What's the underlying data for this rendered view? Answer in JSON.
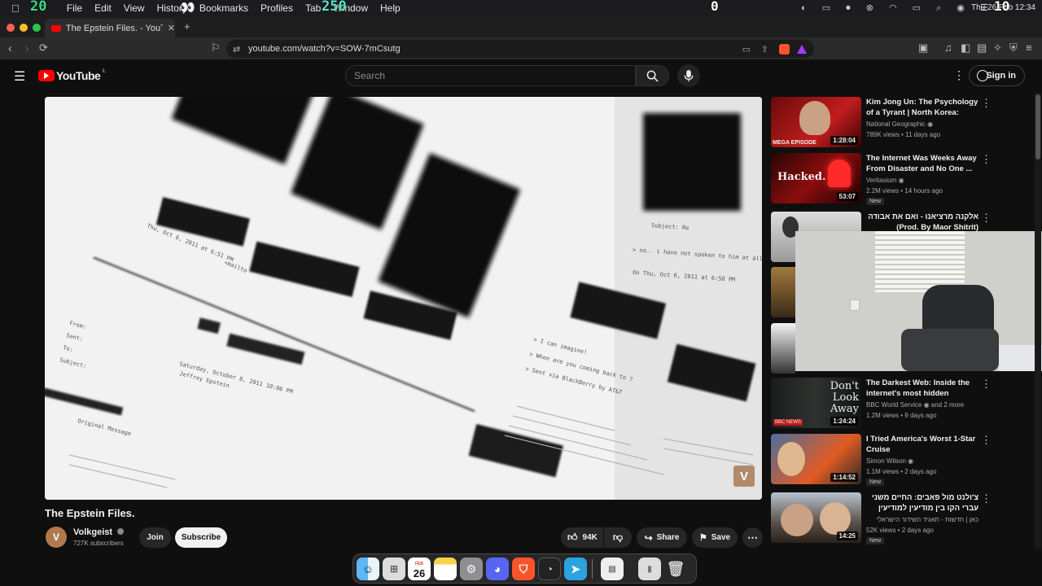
{
  "overlay": {
    "left_num": "20",
    "mid_num1": "250",
    "mid_num2": "0",
    "right_num": "10"
  },
  "menubar": {
    "items": [
      "File",
      "Edit",
      "View",
      "History",
      "Bookmarks",
      "Profiles",
      "Tab",
      "Window",
      "Help"
    ],
    "clock": "Thu 26 Feb  12:34"
  },
  "tab": {
    "title": "The Epstein Files. - YouTube"
  },
  "address": {
    "url": "youtube.com/watch?v=SOW-7mCsutg"
  },
  "youtube": {
    "logo": "YouTube",
    "region": "IL",
    "search_placeholder": "Search",
    "signin": "Sign in"
  },
  "video": {
    "title": "The Epstein Files.",
    "watermark": "V",
    "doc_lines": [
      "Thu, Oct 6, 2011 at 6:51 PM",
      "<mailto",
      "Subject: Re",
      "On Thu, Oct 6, 2011 at 6:58 PM",
      "> I can imagine!",
      "> When are you coming back to ?",
      "> Sent via BlackBerry by AT&T",
      "Saturday, October 8, 2011 10:06 PM",
      "Jeffrey Epstein",
      "From:",
      "Sent:",
      "To:",
      "Subject:",
      "Original Message",
      "> no.. i have not spoken to him at all"
    ]
  },
  "channel": {
    "name": "Volkgeist",
    "subs": "727K subscribers",
    "join": "Join",
    "subscribe": "Subscribe"
  },
  "actions": {
    "likes": "94K",
    "share": "Share",
    "save": "Save"
  },
  "recommendations": [
    {
      "title": "Kim Jong Un: The Psychology of a Tyrant | North Korea: Insid...",
      "channel": "National Geographic",
      "meta": "789K views • 11 days ago",
      "duration": "1:28:04",
      "thumb_text": "MEGA EPISODE",
      "new": ""
    },
    {
      "title": "The Internet Was Weeks Away From Disaster and No One ...",
      "channel": "Veritasium",
      "meta": "2.2M views • 14 hours ago",
      "duration": "53:07",
      "thumb_text": "Hacked.",
      "new": "New"
    },
    {
      "title": "אלקנה מרציאנו - ואם את אבודה (Prod. By Maor Shitrit)",
      "channel": "",
      "meta": "",
      "duration": "",
      "thumb_text": "",
      "new": ""
    },
    {
      "title": "The Darkest Web: Inside the internet's most hidden corners...",
      "channel": "BBC World Service",
      "channel_extra": "and 2 more",
      "meta": "1.2M views • 9 days ago",
      "duration": "1:24:24",
      "thumb_text": "Don't Look Away",
      "new": ""
    },
    {
      "title": "I Tried America's Worst 1-Star Cruise",
      "channel": "Simon Wilson",
      "meta": "1.1M views • 2 days ago",
      "duration": "1:14:52",
      "thumb_text": "",
      "new": "New"
    },
    {
      "title": "צ'ולנט מול פאבים: החיים משני עברי הקו בין מודיעין למודיעין עילית",
      "channel": "כאן | חדשות - תאגיד השידור הישראלי",
      "meta": "52K views • 2 days ago",
      "duration": "14:25",
      "thumb_text": "",
      "new": "New"
    }
  ],
  "dock": {
    "calendar_day": "26",
    "calendar_month": "FEB"
  },
  "colors": {
    "accent": "#ff0000",
    "link": "#3ea6ff",
    "bg": "#0f0f0f"
  }
}
